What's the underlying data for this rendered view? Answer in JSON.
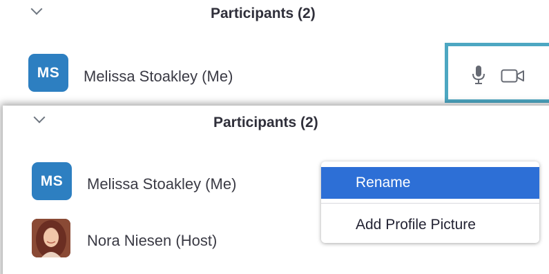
{
  "top_panel": {
    "title": "Participants (2)",
    "participant": {
      "initials": "MS",
      "name": "Melissa Stoakley (Me)",
      "icons": [
        "microphone-icon",
        "video-camera-icon"
      ]
    }
  },
  "bottom_panel": {
    "title": "Participants (2)",
    "participants": [
      {
        "initials": "MS",
        "name": "Melissa Stoakley (Me)"
      },
      {
        "name": "Nora Niesen (Host)",
        "avatar": "profile-photo"
      }
    ]
  },
  "context_menu": {
    "items": [
      {
        "label": "Rename",
        "state": "highlighted"
      },
      {
        "label": "Add Profile Picture"
      }
    ]
  },
  "colors": {
    "avatar_blue": "#2d7fc1",
    "highlight_frame": "#4da7c2",
    "menu_highlight": "#2d6fd6"
  }
}
